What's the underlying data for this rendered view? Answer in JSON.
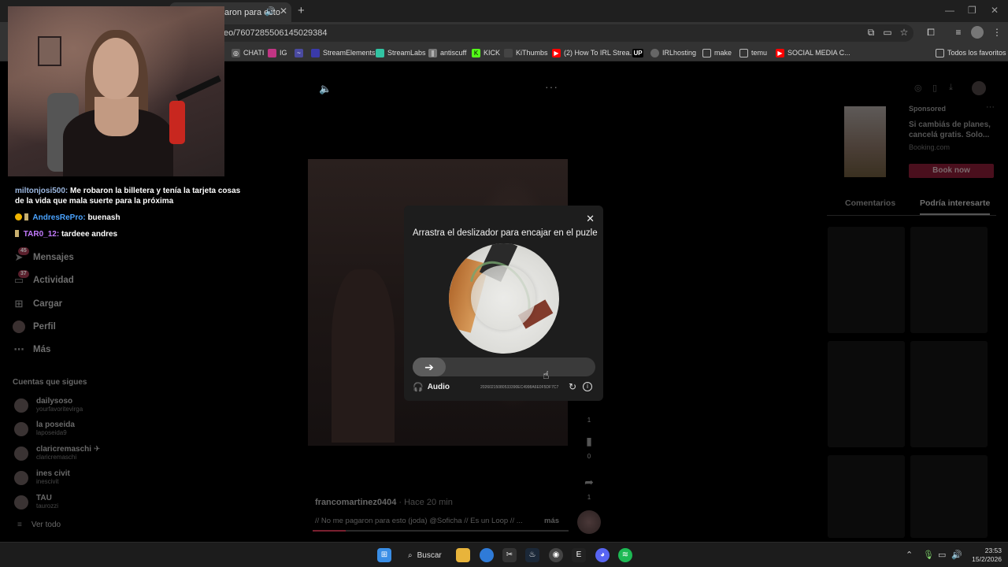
{
  "browser": {
    "tab_title": "aron para esto",
    "url": "eo/7607285506145029384",
    "bookmarks": [
      {
        "label": "CHATI",
        "icon": "openai-icon",
        "color": "#555555"
      },
      {
        "label": "IG",
        "icon": "instagram-icon",
        "color": "#c13584"
      },
      {
        "label": "",
        "icon": "chart-icon",
        "color": "#6a6aff"
      },
      {
        "label": "StreamElements",
        "icon": "streamelements-icon",
        "color": "#3a3aaa"
      },
      {
        "label": "StreamLabs",
        "icon": "streamlabs-icon",
        "color": "#31c3a2"
      },
      {
        "label": "antiscuff",
        "icon": "antiscuff-icon",
        "color": "#777777"
      },
      {
        "label": "KICK",
        "icon": "kick-icon",
        "color": "#53fc18"
      },
      {
        "label": "KiThumbs",
        "icon": "kithumbs-icon",
        "color": "#444444"
      },
      {
        "label": "(2) How To IRL Strea...",
        "icon": "youtube-icon",
        "color": "#ff0000"
      },
      {
        "label": "",
        "icon": "up-icon",
        "color": "#000000"
      },
      {
        "label": "IRLhosting",
        "icon": "irlhosting-icon",
        "color": "#666666"
      },
      {
        "label": "make",
        "icon": "folder-icon",
        "color": "#333333"
      },
      {
        "label": "temu",
        "icon": "folder-icon",
        "color": "#333333"
      },
      {
        "label": "SOCIAL MEDIA C...",
        "icon": "youtube-icon",
        "color": "#ff0000"
      }
    ],
    "all_favorites": "Todos los favoritos",
    "up_label": "UP"
  },
  "chat": [
    {
      "user": "miltonjosi500:",
      "text": "Me robaron la billetera y tenía la tarjeta cosas",
      "text2": "de la vida que mala suerte para la próxima"
    },
    {
      "user": "AndresRePro:",
      "text": "buenash"
    },
    {
      "user": "TAR0_12:",
      "text": "tardeee andres"
    }
  ],
  "nav": [
    {
      "label": "Mensajes",
      "icon": "send-icon",
      "badge": "45"
    },
    {
      "label": "Actividad",
      "icon": "activity-icon",
      "badge": "37"
    },
    {
      "label": "Cargar",
      "icon": "upload-icon"
    },
    {
      "label": "Perfil",
      "icon": "profile-icon"
    },
    {
      "label": "Más",
      "icon": "more-icon"
    }
  ],
  "following": {
    "title": "Cuentas que sigues",
    "items": [
      {
        "name": "dailysoso",
        "handle": "yourfavoritevirga"
      },
      {
        "name": "la poseida",
        "handle": "laposeida9"
      },
      {
        "name": "claricremaschi ✈",
        "handle": "claricremaschi"
      },
      {
        "name": "ines civit",
        "handle": "inescivit"
      },
      {
        "name": "TAU",
        "handle": "taurozzi"
      }
    ],
    "see_all": "Ver todo"
  },
  "video": {
    "author": "francomartinez0404",
    "time": " · Hace 20 min",
    "description": "// No me pagaron para esto (joda) @Soficha // Es un Loop // ...",
    "more": "más",
    "progress": 0.13,
    "counts": {
      "likes": "1",
      "saves": "0",
      "shares": "1"
    }
  },
  "ad": {
    "sponsored": "Sponsored",
    "title": "Si cambiás de planes, cancelá gratis. Solo...",
    "source": "Booking.com",
    "button": "Book now"
  },
  "right_tabs": [
    "Comentarios",
    "Podría interesarte"
  ],
  "captcha": {
    "title": "Arrastra el deslizador para encajar en el puzle",
    "audio": "Audio",
    "id": "20260215080533390EC4998A6E0F5DF7C7"
  },
  "taskbar": {
    "search": "Buscar",
    "time": "23:53",
    "date": "15/2/2026"
  },
  "colors": {
    "accent": "#fe2c55",
    "modal_bg": "#1d1d1d",
    "track": "#3a3a3a"
  }
}
